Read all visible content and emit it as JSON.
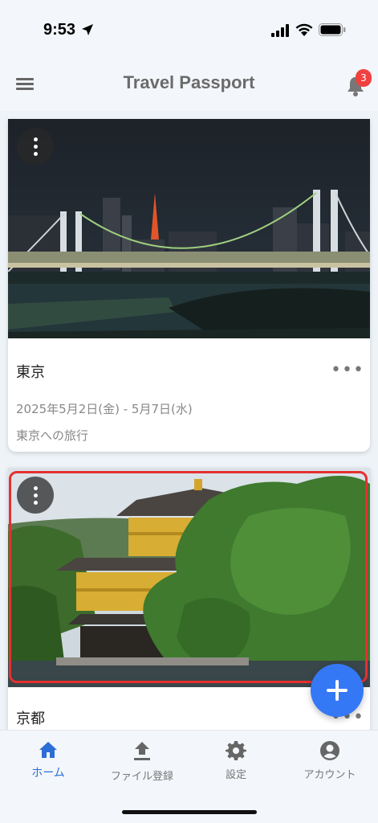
{
  "status_bar": {
    "time": "9:53"
  },
  "app_bar": {
    "title": "Travel Passport",
    "notification_count": "3"
  },
  "trips": [
    {
      "title": "東京",
      "dates": "2025年5月2日(金) - 5月7日(水)",
      "description": "東京への旅行",
      "more_label": "•••"
    },
    {
      "title": "京都",
      "more_label": "•••"
    }
  ],
  "bottom_nav": {
    "items": [
      {
        "label": "ホーム",
        "icon": "home-icon",
        "active": true
      },
      {
        "label": "ファイル登録",
        "icon": "upload-icon",
        "active": false
      },
      {
        "label": "設定",
        "icon": "gear-icon",
        "active": false
      },
      {
        "label": "アカウント",
        "icon": "account-icon",
        "active": false
      }
    ]
  },
  "colors": {
    "accent": "#2b6fd6",
    "fab": "#3478f6",
    "badge": "#f04040",
    "highlight": "#e53030"
  }
}
